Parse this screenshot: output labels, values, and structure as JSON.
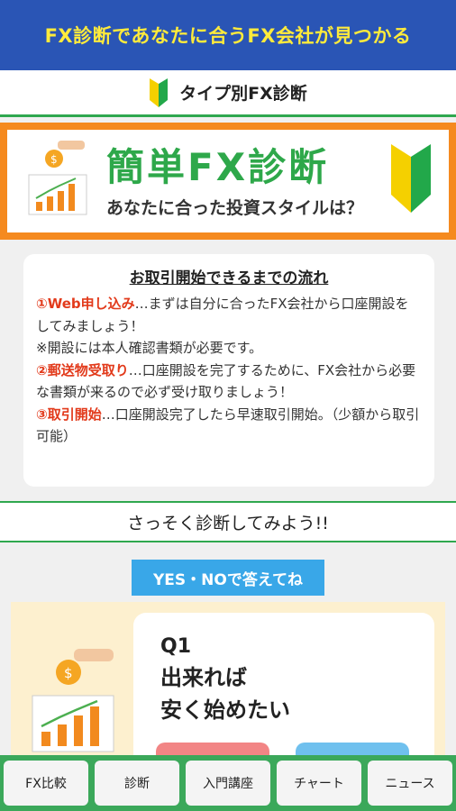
{
  "header": {
    "banner_text": "FX診断であなたに合うFX会社が見つかる"
  },
  "type_section": {
    "title": "タイプ別FX診断"
  },
  "hero": {
    "title": "簡単FX診断",
    "subtitle": "あなたに合った投資スタイルは？"
  },
  "flow": {
    "title": "お取引開始できるまでの流れ",
    "step1_label": "①Web申し込み",
    "step1_text": "…まずは自分に合ったFX会社から口座開設をしてみましょう！",
    "note": "※開設には本人確認書類が必要です。",
    "step2_label": "②郵送物受取り",
    "step2_text": "…口座開設を完了するために、FX会社から必要な書類が来るので必ず受け取りましょう！",
    "step3_label": "③取引開始",
    "step3_text": "…口座開設完了したら早速取引開始。（少額から取引可能）"
  },
  "cta": {
    "text": "さっそく診断してみよう!!"
  },
  "yesno_label": "YES・NOで答えてね",
  "question": {
    "number": "Q1",
    "line1": "出来れば",
    "line2": "安く始めたい"
  },
  "bottom_nav": [
    "FX比較",
    "診断",
    "入門講座",
    "チャート",
    "ニュース"
  ],
  "colors": {
    "banner": "#2a55b5",
    "banner_text": "#ffeb3b",
    "accent_green": "#2fa84f",
    "hero_border": "#f58a1f",
    "red": "#e23a1b",
    "blue_label": "#39a7e8"
  }
}
